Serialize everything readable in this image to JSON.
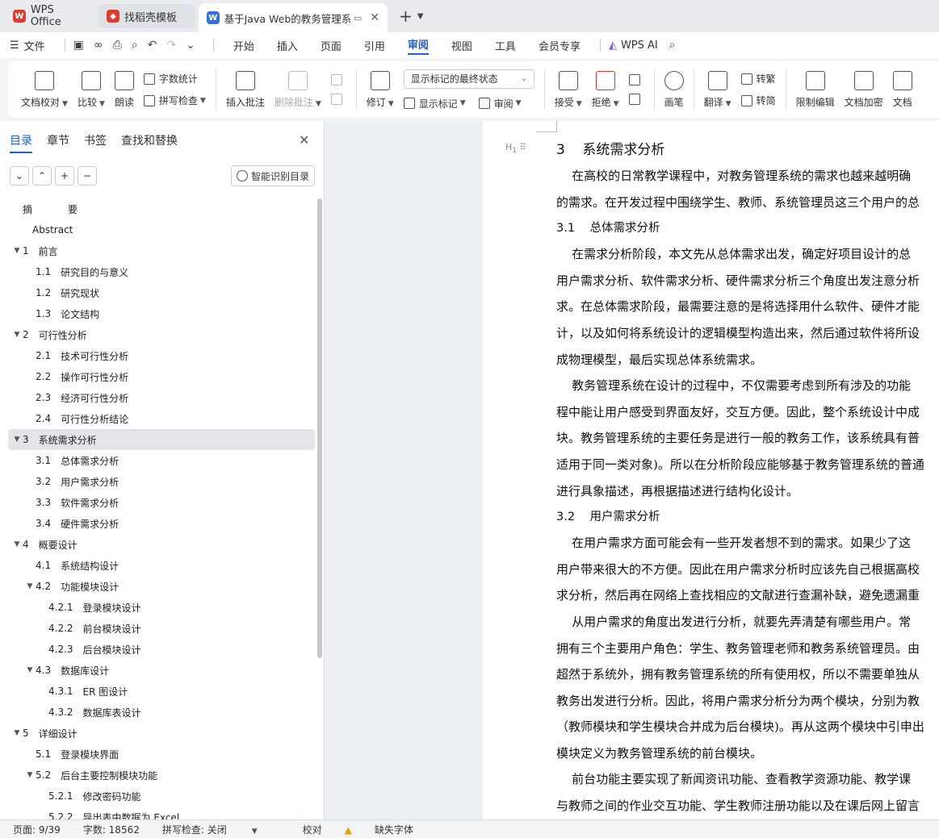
{
  "tabs": {
    "wps": "WPS Office",
    "templates": "找稻壳模板",
    "document": "基于Java Web的教务管理系统"
  },
  "menu": {
    "file": "文件",
    "tabs": [
      "开始",
      "插入",
      "页面",
      "引用",
      "审阅",
      "视图",
      "工具",
      "会员专享"
    ],
    "active_tab": "审阅",
    "wps_ai": "WPS AI"
  },
  "ribbon": {
    "doc_proofread": "文档校对",
    "compare": "比较",
    "read_aloud": "朗读",
    "word_count": "字数统计",
    "spell_check": "拼写检查",
    "insert_comment": "插入批注",
    "delete_comment": "删除批注",
    "revise": "修订",
    "markup_state": "显示标记的最终状态",
    "show_markup": "显示标记",
    "review": "审阅",
    "accept": "接受",
    "reject": "拒绝",
    "pen": "画笔",
    "translate": "翻译",
    "to_traditional": "转繁",
    "to_simplified": "转简",
    "restrict_edit": "限制编辑",
    "encrypt": "文档加密",
    "doc_right": "文档"
  },
  "nav": {
    "tabs": [
      "目录",
      "章节",
      "书签",
      "查找和替换"
    ],
    "smart_toc": "智能识别目录",
    "items": [
      {
        "num": "摘",
        "label": "要",
        "level": 0,
        "arrow": ""
      },
      {
        "num": "",
        "label": "Abstract",
        "level": 0,
        "arrow": ""
      },
      {
        "num": "1",
        "label": "前言",
        "level": 0,
        "arrow": "▼"
      },
      {
        "num": "1.1",
        "label": "研究目的与意义",
        "level": 1,
        "arrow": ""
      },
      {
        "num": "1.2",
        "label": "研究现状",
        "level": 1,
        "arrow": ""
      },
      {
        "num": "1.3",
        "label": "论文结构",
        "level": 1,
        "arrow": ""
      },
      {
        "num": "2",
        "label": "可行性分析",
        "level": 0,
        "arrow": "▼"
      },
      {
        "num": "2.1",
        "label": "技术可行性分析",
        "level": 1,
        "arrow": ""
      },
      {
        "num": "2.2",
        "label": "操作可行性分析",
        "level": 1,
        "arrow": ""
      },
      {
        "num": "2.3",
        "label": "经济可行性分析",
        "level": 1,
        "arrow": ""
      },
      {
        "num": "2.4",
        "label": "可行性分析结论",
        "level": 1,
        "arrow": ""
      },
      {
        "num": "3",
        "label": "系统需求分析",
        "level": 0,
        "arrow": "▼",
        "selected": true
      },
      {
        "num": "3.1",
        "label": "总体需求分析",
        "level": 1,
        "arrow": ""
      },
      {
        "num": "3.2",
        "label": "用户需求分析",
        "level": 1,
        "arrow": ""
      },
      {
        "num": "3.3",
        "label": "软件需求分析",
        "level": 1,
        "arrow": ""
      },
      {
        "num": "3.4",
        "label": "硬件需求分析",
        "level": 1,
        "arrow": ""
      },
      {
        "num": "4",
        "label": "概要设计",
        "level": 0,
        "arrow": "▼"
      },
      {
        "num": "4.1",
        "label": "系统结构设计",
        "level": 1,
        "arrow": ""
      },
      {
        "num": "4.2",
        "label": "功能模块设计",
        "level": 1,
        "arrow": "▼"
      },
      {
        "num": "4.2.1",
        "label": "登录模块设计",
        "level": 2,
        "arrow": ""
      },
      {
        "num": "4.2.2",
        "label": "前台模块设计",
        "level": 2,
        "arrow": ""
      },
      {
        "num": "4.2.3",
        "label": "后台模块设计",
        "level": 2,
        "arrow": ""
      },
      {
        "num": "4.3",
        "label": "数据库设计",
        "level": 1,
        "arrow": "▼"
      },
      {
        "num": "4.3.1",
        "label": "ER 图设计",
        "level": 2,
        "arrow": ""
      },
      {
        "num": "4.3.2",
        "label": "数据库表设计",
        "level": 2,
        "arrow": ""
      },
      {
        "num": "5",
        "label": "详细设计",
        "level": 0,
        "arrow": "▼"
      },
      {
        "num": "5.1",
        "label": "登录模块界面",
        "level": 1,
        "arrow": ""
      },
      {
        "num": "5.2",
        "label": "后台主要控制模块功能",
        "level": 1,
        "arrow": "▼"
      },
      {
        "num": "5.2.1",
        "label": "修改密码功能",
        "level": 2,
        "arrow": ""
      },
      {
        "num": "5.2.2",
        "label": "导出表中数据为 Excel",
        "level": 2,
        "arrow": ""
      }
    ]
  },
  "document": {
    "lines": [
      {
        "type": "h1",
        "text": "3    系统需求分析"
      },
      {
        "type": "p",
        "text": "    在高校的日常教学课程中，对教务管理系统的需求也越来越明确"
      },
      {
        "type": "p",
        "text": "的需求。在开发过程中围绕学生、教师、系统管理员这三个用户的总"
      },
      {
        "type": "h2",
        "text": "3.1    总体需求分析"
      },
      {
        "type": "p",
        "text": "    在需求分析阶段，本文先从总体需求出发，确定好项目设计的总"
      },
      {
        "type": "p",
        "text": "用户需求分析、软件需求分析、硬件需求分析三个角度出发注意分析"
      },
      {
        "type": "p",
        "text": "求。在总体需求阶段，最需要注意的是将选择用什么软件、硬件才能"
      },
      {
        "type": "p",
        "text": "计，以及如何将系统设计的逻辑模型构造出来，然后通过软件将所设"
      },
      {
        "type": "p",
        "text": "成物理模型，最后实现总体系统需求。"
      },
      {
        "type": "p",
        "text": "    教务管理系统在设计的过程中，不仅需要考虑到所有涉及的功能"
      },
      {
        "type": "p",
        "text": "程中能让用户感受到界面友好，交互方便。因此，整个系统设计中成"
      },
      {
        "type": "p",
        "text": "块。教务管理系统的主要任务是进行一般的教务工作，该系统具有普"
      },
      {
        "type": "p",
        "text": "适用于同一类对象)。所以在分析阶段应能够基于教务管理系统的普通"
      },
      {
        "type": "p",
        "text": "进行具象描述，再根据描述进行结构化设计。"
      },
      {
        "type": "h2",
        "text": "3.2    用户需求分析"
      },
      {
        "type": "p",
        "text": "    在用户需求方面可能会有一些开发者想不到的需求。如果少了这"
      },
      {
        "type": "p",
        "text": "用户带来很大的不方便。因此在用户需求分析时应该先自己根据高校"
      },
      {
        "type": "p",
        "text": "求分析，然后再在网络上查找相应的文献进行查漏补缺，避免遗漏重"
      },
      {
        "type": "p",
        "text": "    从用户需求的角度出发进行分析，就要先弄清楚有哪些用户。常"
      },
      {
        "type": "p",
        "text": "拥有三个主要用户角色：学生、教务管理老师和教务系统管理员。由"
      },
      {
        "type": "p",
        "text": "超然于系统外，拥有教务管理系统的所有使用权，所以不需要单独从"
      },
      {
        "type": "p",
        "text": "教务出发进行分析。因此，将用户需求分析分为两个模块，分别为教"
      },
      {
        "type": "p",
        "text": "（教师模块和学生模块合并成为后台模块)。再从这两个模块中引申出"
      },
      {
        "type": "p",
        "text": "模块定义为教务管理系统的前台模块。"
      },
      {
        "type": "p",
        "text": "    前台功能主要实现了新闻资讯功能、查看教学资源功能、教学课"
      },
      {
        "type": "p",
        "text": "与教师之间的作业交互功能、学生教师注册功能以及在课后网上留言"
      }
    ]
  },
  "status": {
    "page": "页面: 9/39",
    "words": "字数: 18562",
    "spell": "拼写检查: 关闭",
    "proof": "校对",
    "missing_font": "缺失字体"
  }
}
